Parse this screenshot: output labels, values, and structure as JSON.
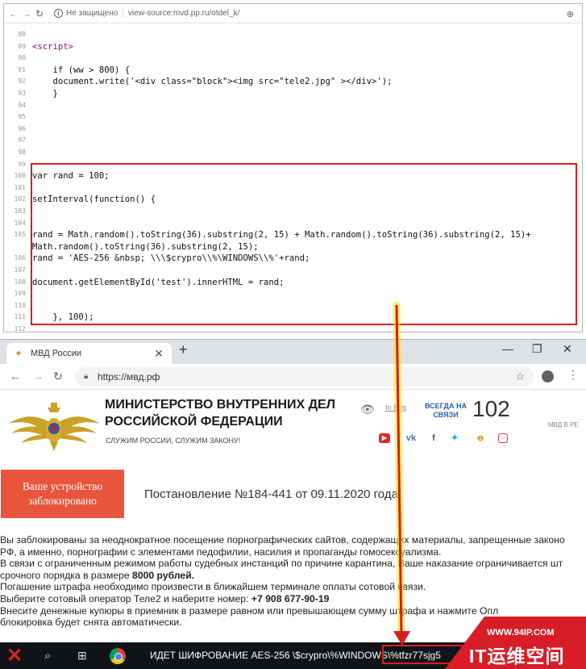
{
  "source_window": {
    "address_warning": "Не защищено",
    "address_url": "view-source:mvd.pp.ru/otdel_k/",
    "lines": [
      {
        "n": "88",
        "text": ""
      },
      {
        "n": "89",
        "text": "<script>"
      },
      {
        "n": "90",
        "text": ""
      },
      {
        "n": "91",
        "text": "    if (ww > 800) {"
      },
      {
        "n": "92",
        "text": "    document.write('<div class=\"block\"><img src=\"tele2.jpg\" ></div>');"
      },
      {
        "n": "93",
        "text": "    }"
      },
      {
        "n": "94",
        "text": ""
      },
      {
        "n": "95",
        "text": ""
      },
      {
        "n": "96",
        "text": ""
      },
      {
        "n": "97",
        "text": ""
      },
      {
        "n": "98",
        "text": ""
      },
      {
        "n": "99",
        "text": ""
      },
      {
        "n": "100",
        "text": "var rand = 100;"
      },
      {
        "n": "101",
        "text": ""
      },
      {
        "n": "102",
        "text": "setInterval(function() {"
      },
      {
        "n": "103",
        "text": ""
      },
      {
        "n": "104",
        "text": ""
      },
      {
        "n": "105",
        "text": "rand = Math.random().toString(36).substring(2, 15) + Math.random().toString(36).substring(2, 15)+"
      },
      {
        "n": "",
        "text": "Math.random().toString(36).substring(2, 15);"
      },
      {
        "n": "106",
        "text": "rand = 'AES-256 &nbsp; \\\\\\$crypro\\\\%\\WINDOWS\\\\%'+rand;"
      },
      {
        "n": "107",
        "text": ""
      },
      {
        "n": "108",
        "text": "document.getElementById('test').innerHTML = rand;"
      },
      {
        "n": "109",
        "text": ""
      },
      {
        "n": "110",
        "text": ""
      },
      {
        "n": "111",
        "text": "    }, 100);"
      },
      {
        "n": "112",
        "text": ""
      }
    ]
  },
  "browser": {
    "tab_title": "МВД России",
    "url": "https://мвд.рф"
  },
  "page": {
    "ministry_title": "Министерство внутренних дел Российской Федерации",
    "slogan": "Служим России, служим закону!",
    "eye_label": "In Eng",
    "contact_label": "Всегда на связи",
    "hotline": "102",
    "corner_text": "МВД В РЕ",
    "blocked_badge": "Ваше устройство заблокировано",
    "decree": "Постановление №184-441 от 09.11.2020 года.",
    "paragraphs": [
      {
        "text": "Вы заблокированы за неоднократное посещение порнографических сайтов, содержащих материалы, запрещенные законо"
      },
      {
        "text": "РФ, а именно, порнографии с элементами педофилии, насилия и пропаганды гомосексуализма."
      },
      {
        "text": "В связи с ограниченным режимом работы судебных инстанций по причине карантина, Ваше наказание ограничивается шт"
      },
      {
        "text": "срочного порядка в размере ",
        "strong": "8000 рублей."
      },
      {
        "text": "Погашение штрафа необходимо произвести в ближайшем терминале оплаты сотовой связи."
      },
      {
        "text": "Выберите сотовый оператор Теле2 и наберите номер: ",
        "strong": "+7 908 677-90-19"
      },
      {
        "text": "Внесите денежные купюры в приемник в размере равном или превышающем сумму штрафа и нажмите Опл"
      },
      {
        "text": "блокировка будет снята автоматически."
      }
    ]
  },
  "taskbar": {
    "ticker": "ИДЕТ ШИФРОВАНИЕ AES-256   \\$crypro\\%WINDOWS\\%tfzr77sjg5"
  },
  "watermark": {
    "url": "WWW.94IP.COM",
    "name": "IT运维空间"
  },
  "colors": {
    "highlight_red": "#d91d1d",
    "arrow_yellow": "#f5e600",
    "badge_orange": "#e8553c",
    "contact_blue": "#2a5db0",
    "watermark_red": "#d71e28"
  },
  "icons": [
    "back-icon",
    "forward-icon",
    "reload-icon",
    "warning-icon",
    "zoom-icon",
    "lock-icon",
    "star-icon",
    "eye-icon",
    "youtube-icon",
    "vk-icon",
    "facebook-icon",
    "twitter-icon",
    "ok-icon",
    "instagram-icon",
    "search-icon",
    "task-view-icon",
    "chrome-icon"
  ]
}
